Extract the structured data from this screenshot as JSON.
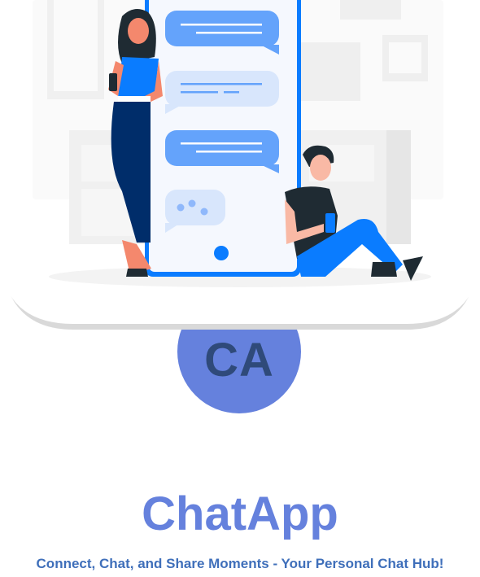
{
  "logo": {
    "initials": "CA",
    "color": "#6581dd",
    "text_color": "#2f4a7a"
  },
  "app": {
    "title": "ChatApp",
    "tagline": "Connect, Chat, and Share Moments - Your Personal Chat Hub!"
  },
  "colors": {
    "accent": "#6581dd",
    "phone": "#0a7cff",
    "bubble_dark": "#64a3fb",
    "bubble_light": "#d8e6fc"
  }
}
